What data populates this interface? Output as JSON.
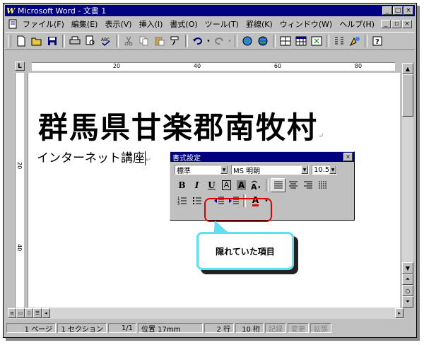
{
  "window": {
    "title": "Microsoft Word - 文書 1",
    "app_icon": "W"
  },
  "menu": {
    "items": [
      "ファイル(F)",
      "編集(E)",
      "表示(V)",
      "挿入(I)",
      "書式(O)",
      "ツール(T)",
      "罫線(K)",
      "ウィンドウ(W)",
      "ヘルプ(H)"
    ]
  },
  "ruler": {
    "corner": "L",
    "labels": [
      "20",
      "40",
      "60",
      "80"
    ]
  },
  "vruler": {
    "labels": [
      "20",
      "40"
    ]
  },
  "document": {
    "heading": "群馬県甘楽郡南牧村",
    "line2": "インターネット講座",
    "return_mark": "↵"
  },
  "format_toolbar": {
    "title": "書式設定",
    "close": "×",
    "style": "標準",
    "font": "MS 明朝",
    "size": "10.5",
    "bold": "B",
    "italic": "I",
    "underline": "U",
    "char_border": "A",
    "char_shade": "A",
    "font_color": "A"
  },
  "callout": {
    "text": "隠れていた項目"
  },
  "status": {
    "page": "1 ページ",
    "section": "1 セクション",
    "pages": "1/1",
    "position": "位置 17mm",
    "line": "2 行",
    "column": "10 桁",
    "rec": "記録",
    "trk": "変更",
    "ext": "拡張"
  },
  "colors": {
    "titlebar": "#000080",
    "highlight": "#e00000",
    "callout_border": "#5fe0f0"
  }
}
